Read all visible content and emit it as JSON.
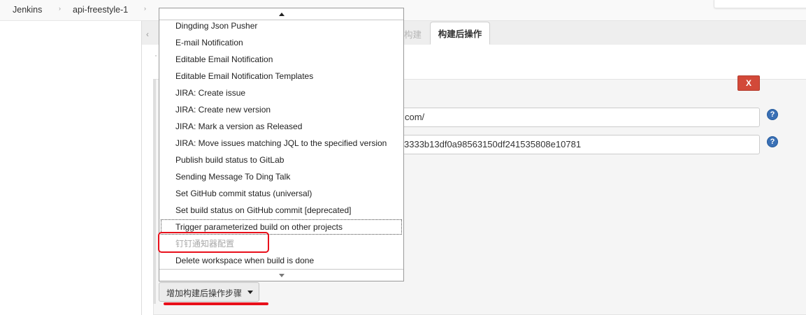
{
  "breadcrumb": {
    "items": [
      "Jenkins",
      "api-freestyle-1"
    ],
    "separator": "›"
  },
  "tabs": {
    "partial_hidden_label": "构建",
    "active_label": "构建后操作"
  },
  "section": {
    "delete_label": "X",
    "url_field_value": "com/",
    "token_field_value": "3333b13df0a98563150df241535808e10781",
    "help_icon": "?"
  },
  "dropdown": {
    "items": [
      {
        "label": "Dingding Json Pusher",
        "state": "normal"
      },
      {
        "label": "E-mail Notification",
        "state": "normal"
      },
      {
        "label": "Editable Email Notification",
        "state": "normal"
      },
      {
        "label": "Editable Email Notification Templates",
        "state": "normal"
      },
      {
        "label": "JIRA: Create issue",
        "state": "normal"
      },
      {
        "label": "JIRA: Create new version",
        "state": "normal"
      },
      {
        "label": "JIRA: Mark a version as Released",
        "state": "normal"
      },
      {
        "label": "JIRA: Move issues matching JQL to the specified version",
        "state": "normal"
      },
      {
        "label": "Publish build status to GitLab",
        "state": "normal"
      },
      {
        "label": "Sending Message To Ding Talk",
        "state": "normal"
      },
      {
        "label": "Set GitHub commit status (universal)",
        "state": "normal"
      },
      {
        "label": "Set build status on GitHub commit [deprecated]",
        "state": "normal"
      },
      {
        "label": "Trigger parameterized build on other projects",
        "state": "focused"
      },
      {
        "label": "钉钉通知器配置",
        "state": "disabled"
      },
      {
        "label": "Delete workspace when build is done",
        "state": "normal"
      }
    ]
  },
  "add_step_button": {
    "label": "增加构建后操作步骤"
  },
  "colors": {
    "annotation_red": "#e8101b",
    "delete_button": "#d24939",
    "help_icon": "#3a70b5"
  }
}
